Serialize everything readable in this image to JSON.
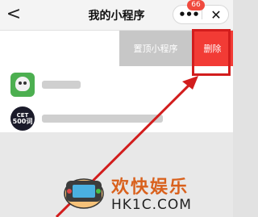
{
  "nav": {
    "back_glyph": "<",
    "title": "我的小程序",
    "more_glyph": "•••",
    "close_glyph": "✕",
    "badge": "66"
  },
  "swipe_actions": {
    "pin_label": "置顶小程序",
    "delete_label": "删除"
  },
  "apps": [
    {
      "icon": "cartoon-mascot-icon"
    },
    {
      "icon": "cet-500-icon",
      "icon_text_top": "CET",
      "icon_text_bottom": "500词"
    }
  ],
  "watermark": {
    "line1": "欢快娱乐",
    "line2": "HK1C.COM"
  },
  "colors": {
    "delete": "#f23b35",
    "pin": "#c7c7c7",
    "annotation": "#d21d1d",
    "badge": "#f04a3e"
  }
}
